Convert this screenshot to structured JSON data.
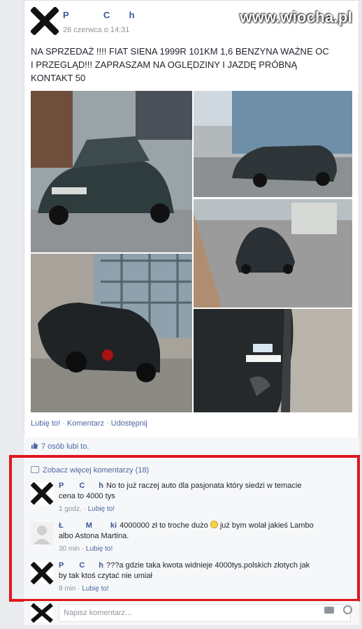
{
  "watermark": "www.wiocha.pl",
  "post": {
    "author_first": "P",
    "author_second": "C",
    "author_third": "h",
    "timestamp": "26 czerwca o 14:31",
    "text_line1": "NA SPRZEDAŻ !!!! FIAT SIENA 1999R 101KM 1,6 BENZYNA WAŻNE OC",
    "text_line2": "I PRZEGLĄD!!! ZAPRASZAM NA OGLĘDZINY I JAZDĘ PRÓBNĄ",
    "text_line3": "KONTAKT 50",
    "photos": [
      "car-front",
      "car-rear-right",
      "car-street",
      "car-rear-left",
      "car-bumper-close"
    ]
  },
  "actions": {
    "like": "Lubię to!",
    "comment": "Komentarz",
    "share": "Udostępnij"
  },
  "likes": {
    "text": "7 osób lubi to."
  },
  "see_more": "Zobacz więcej komentarzy (18)",
  "comments": [
    {
      "name_a": "P",
      "name_b": "C",
      "name_c": "h",
      "text_line1": "No to już raczej auto dla pasjonata który siedzi w temacie",
      "text_line2": "cena to 4000 tys",
      "time": "1 godz.",
      "like": "Lubię to!"
    },
    {
      "name_a": "Ł",
      "name_b": "M",
      "name_c": "ki",
      "text_before_emoji": "4000000 zł to troche dużo",
      "text_after_emoji": "już bym wolał jakieś Lambo",
      "text_line2": "albo Astona Martina.",
      "time": "30 min",
      "like": "Lubię to!"
    },
    {
      "name_a": "P",
      "name_b": "C",
      "name_c": "h",
      "text_line1": "???a gdzie taka kwota widnieje 4000tys.polskich złotych jak",
      "text_line2": "by tak ktoś czytać nie umiał",
      "time": "8 min",
      "like": "Lubię to!"
    }
  ],
  "write_comment": {
    "placeholder": "Napisz komentarz..."
  }
}
